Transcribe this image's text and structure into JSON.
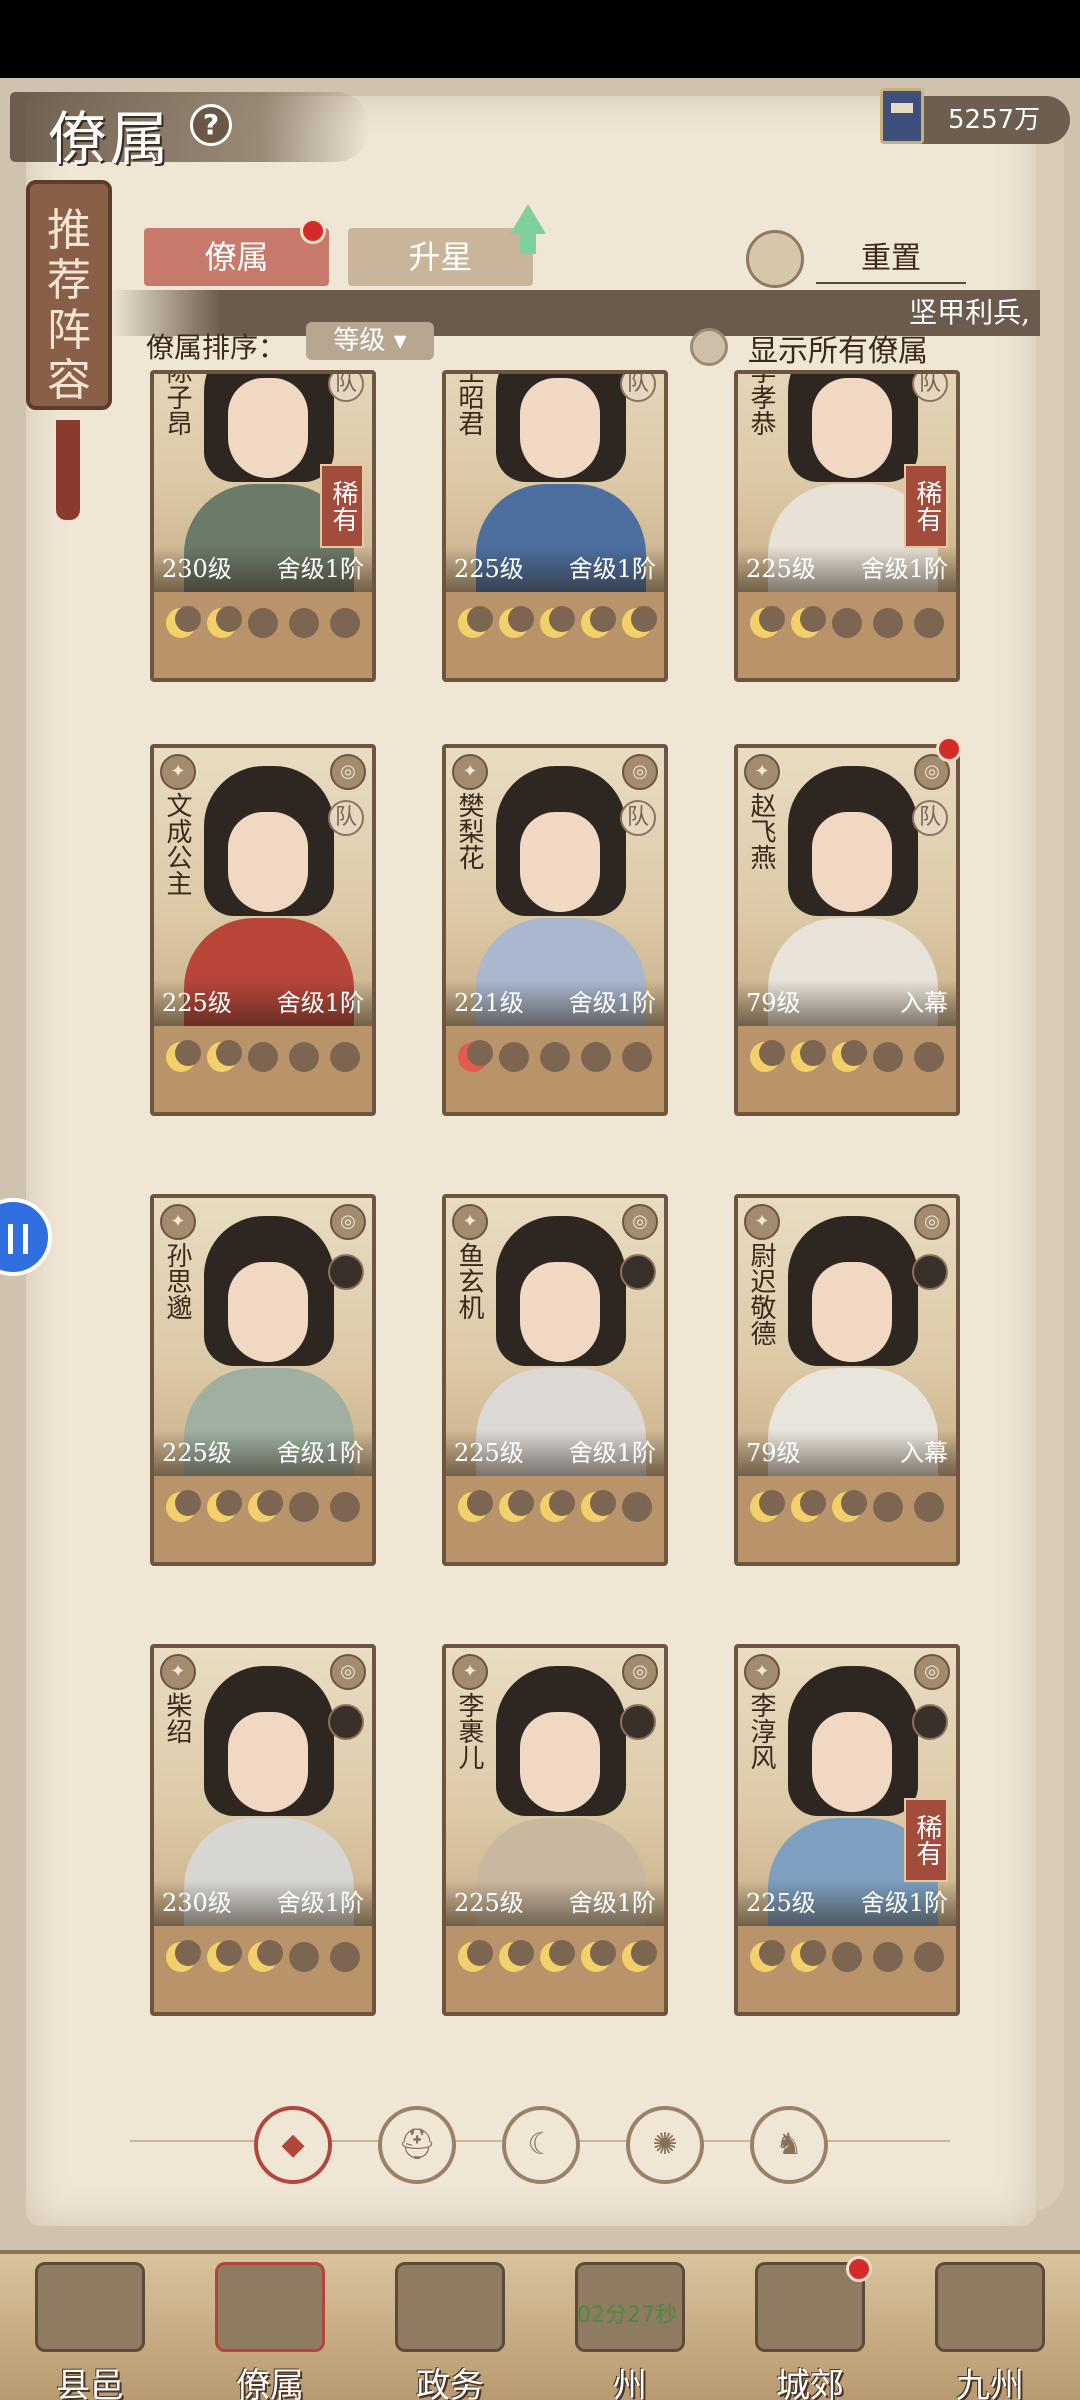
{
  "header": {
    "title": "僚属",
    "help_icon": "?",
    "currency_amount": "5257万"
  },
  "recommend_scroll": {
    "label": "推荐阵容"
  },
  "tabs": [
    {
      "label": "僚属",
      "active": true,
      "badge": true
    },
    {
      "label": "升星",
      "active": false
    }
  ],
  "reset_label": "重置",
  "marquee_text": "坚甲利兵,",
  "sort": {
    "label": "僚属排序：",
    "value": "等级 ▾"
  },
  "show_all_label": "显示所有僚属",
  "cards": [
    {
      "name": "陈子昂",
      "level": "230级",
      "status": "舍级1阶",
      "rare": "稀有",
      "team": "队",
      "moons": [
        "on",
        "on",
        "off",
        "off",
        "off"
      ]
    },
    {
      "name": "王昭君",
      "level": "225级",
      "status": "舍级1阶",
      "rare": "",
      "team": "队",
      "moons": [
        "on",
        "on",
        "on",
        "on",
        "on"
      ]
    },
    {
      "name": "李孝恭",
      "level": "225级",
      "status": "舍级1阶",
      "rare": "稀有",
      "team": "队",
      "moons": [
        "on",
        "on",
        "off",
        "off",
        "off"
      ]
    },
    {
      "name": "文成公主",
      "level": "225级",
      "status": "舍级1阶",
      "rare": "",
      "team": "队",
      "moons": [
        "on",
        "on",
        "off",
        "off",
        "off"
      ]
    },
    {
      "name": "樊梨花",
      "level": "221级",
      "status": "舍级1阶",
      "rare": "",
      "team": "队",
      "moons": [
        "red",
        "off",
        "off",
        "off",
        "off"
      ]
    },
    {
      "name": "赵飞燕",
      "level": "79级",
      "status": "入幕",
      "rare": "",
      "team": "队",
      "moons": [
        "on",
        "on",
        "on",
        "off",
        "off"
      ]
    },
    {
      "name": "孙思邈",
      "level": "225级",
      "status": "舍级1阶",
      "rare": "",
      "team": "",
      "moons": [
        "on",
        "on",
        "on",
        "off",
        "off"
      ]
    },
    {
      "name": "鱼玄机",
      "level": "225级",
      "status": "舍级1阶",
      "rare": "",
      "team": "",
      "moons": [
        "on",
        "on",
        "on",
        "on",
        "off"
      ]
    },
    {
      "name": "尉迟敬德",
      "level": "79级",
      "status": "入幕",
      "rare": "",
      "team": "",
      "moons": [
        "on",
        "on",
        "on",
        "off",
        "off"
      ]
    },
    {
      "name": "柴绍",
      "level": "230级",
      "status": "舍级1阶",
      "rare": "",
      "team": "",
      "moons": [
        "on",
        "on",
        "on",
        "off",
        "off"
      ]
    },
    {
      "name": "李裹儿",
      "level": "225级",
      "status": "舍级1阶",
      "rare": "",
      "team": "",
      "moons": [
        "on",
        "on",
        "on",
        "on",
        "on"
      ]
    },
    {
      "name": "李淳风",
      "level": "225级",
      "status": "舍级1阶",
      "rare": "稀有",
      "team": "",
      "moons": [
        "on",
        "on",
        "off",
        "off",
        "off"
      ]
    }
  ],
  "filters": [
    {
      "icon": "all-diamond-icon",
      "active": true
    },
    {
      "icon": "helmet-icon",
      "active": false
    },
    {
      "icon": "cat-icon",
      "active": false
    },
    {
      "icon": "fan-icon",
      "active": false
    },
    {
      "icon": "lion-icon",
      "active": false
    }
  ],
  "bottom_nav": [
    {
      "label": "县邑"
    },
    {
      "label": "僚属"
    },
    {
      "label": "政务"
    },
    {
      "label": "州"
    },
    {
      "label": "城郊"
    },
    {
      "label": "九州"
    }
  ],
  "timer_text": "02分27秒"
}
